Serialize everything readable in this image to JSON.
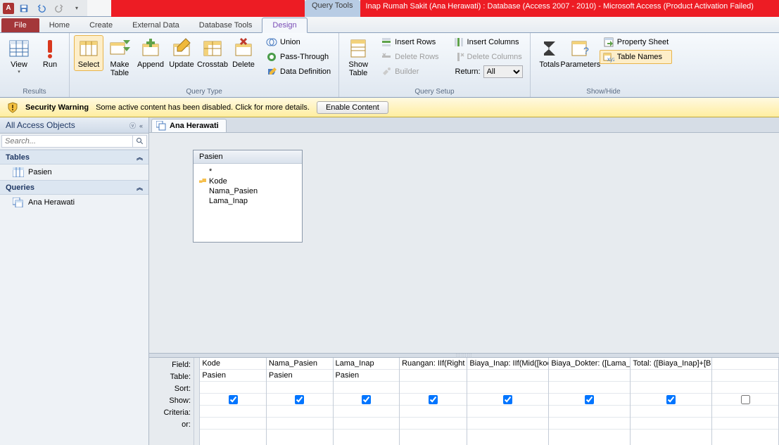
{
  "titlebar": {
    "tool_context": "Query Tools",
    "title": "Inap Rumah Sakit (Ana Herawati) : Database (Access 2007 - 2010) - Microsoft Access (Product Activation Failed)"
  },
  "tabs": {
    "file": "File",
    "items": [
      "Home",
      "Create",
      "External Data",
      "Database Tools"
    ],
    "design": "Design"
  },
  "ribbon": {
    "results": {
      "label": "Results",
      "view": "View",
      "run": "Run"
    },
    "querytype": {
      "label": "Query Type",
      "select": "Select",
      "maketable": "Make\nTable",
      "append": "Append",
      "update": "Update",
      "crosstab": "Crosstab",
      "delete": "Delete",
      "union": "Union",
      "passthrough": "Pass-Through",
      "datadef": "Data Definition"
    },
    "querysetup": {
      "label": "Query Setup",
      "showtable": "Show\nTable",
      "insrows": "Insert Rows",
      "delrows": "Delete Rows",
      "builder": "Builder",
      "inscols": "Insert Columns",
      "delcols": "Delete Columns",
      "return": "Return:",
      "return_val": "All"
    },
    "showhide": {
      "label": "Show/Hide",
      "totals": "Totals",
      "params": "Parameters",
      "propsheet": "Property Sheet",
      "tablenames": "Table Names"
    }
  },
  "msgbar": {
    "title": "Security Warning",
    "text": "Some active content has been disabled. Click for more details.",
    "button": "Enable Content"
  },
  "nav": {
    "title": "All Access Objects",
    "search_ph": "Search...",
    "tables_h": "Tables",
    "tables": [
      "Pasien"
    ],
    "queries_h": "Queries",
    "queries": [
      "Ana Herawati"
    ]
  },
  "doc": {
    "tab": "Ana Herawati"
  },
  "tablebox": {
    "name": "Pasien",
    "star": "*",
    "fields": [
      "Kode",
      "Nama_Pasien",
      "Lama_Inap"
    ]
  },
  "gridlabels": {
    "field": "Field:",
    "table": "Table:",
    "sort": "Sort:",
    "show": "Show:",
    "criteria": "Criteria:",
    "or": "or:"
  },
  "gridcols": [
    {
      "field": "Kode",
      "table": "Pasien",
      "show": true,
      "active": false
    },
    {
      "field": "Nama_Pasien",
      "table": "Pasien",
      "show": true,
      "active": false
    },
    {
      "field": "Lama_Inap",
      "table": "Pasien",
      "show": true,
      "active": false
    },
    {
      "field": "Ruangan: IIf(Right",
      "table": "",
      "show": true,
      "active": true
    },
    {
      "field": "Biaya_Inap: IIf(Mid([kode",
      "table": "",
      "show": true,
      "active": false
    },
    {
      "field": "Biaya_Dokter: ([Lama_",
      "table": "",
      "show": true,
      "active": false
    },
    {
      "field": "Total: ([Biaya_Inap]+[B",
      "table": "",
      "show": true,
      "active": false
    }
  ]
}
